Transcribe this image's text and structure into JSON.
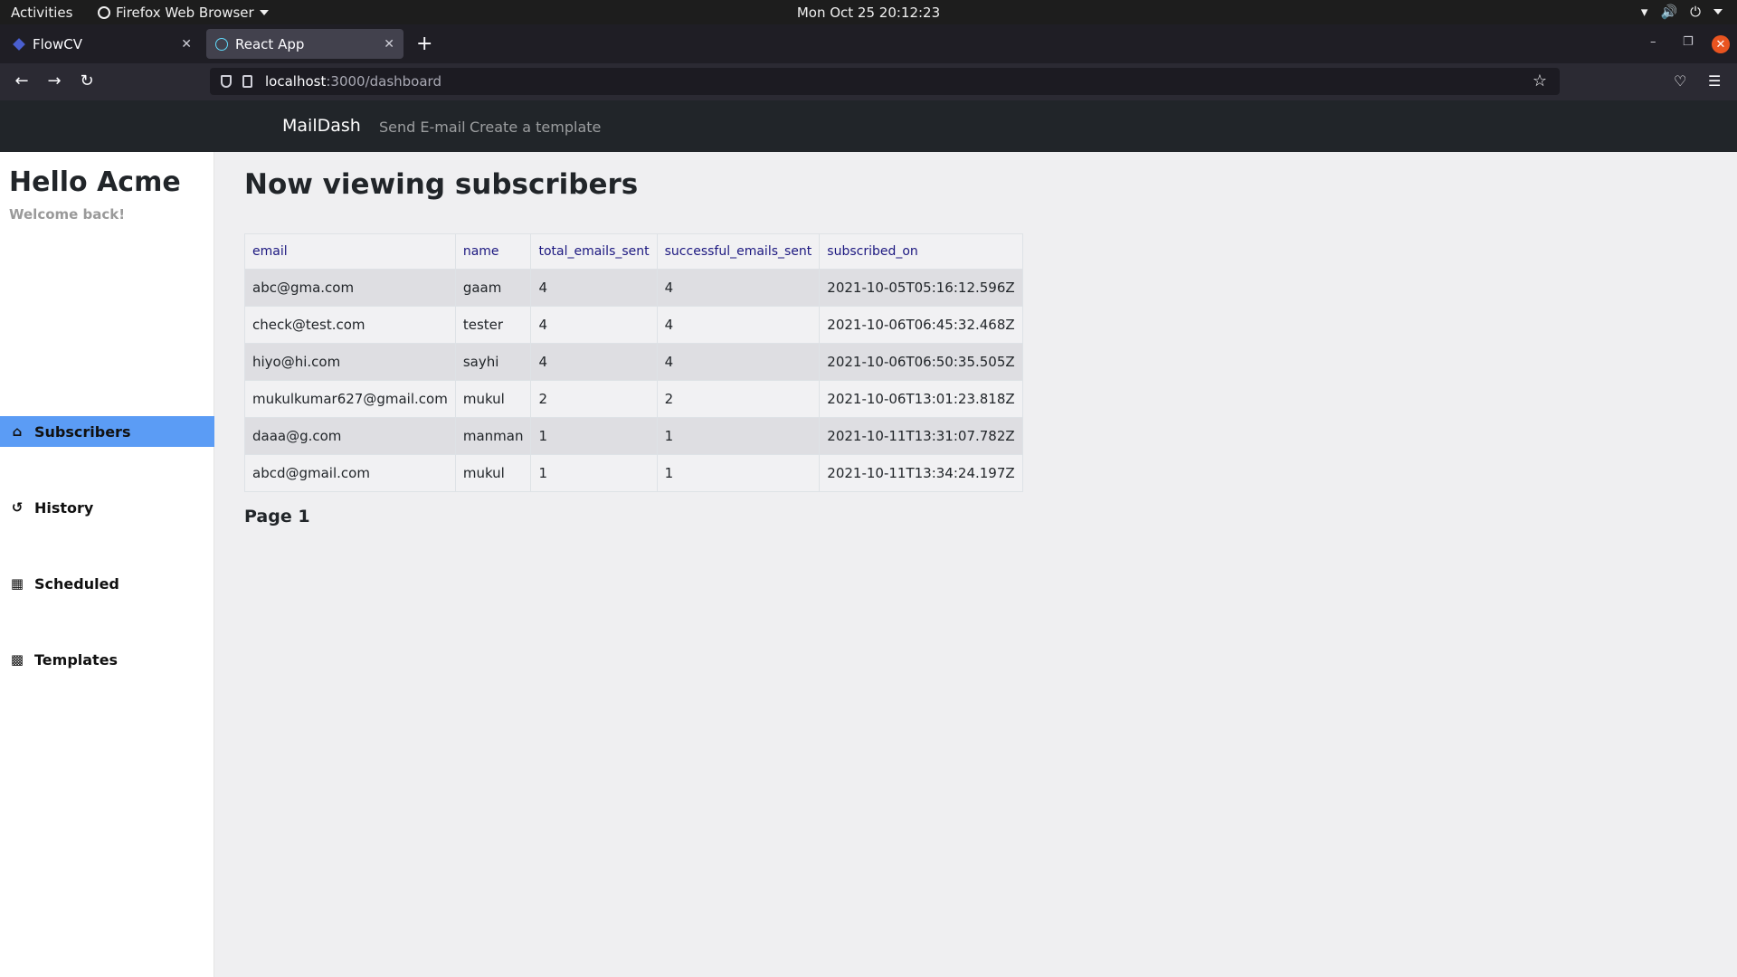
{
  "os": {
    "activities": "Activities",
    "app_name": "Firefox Web Browser",
    "clock": "Mon Oct 25  20:12:23"
  },
  "browser": {
    "tabs": [
      {
        "label": "FlowCV",
        "active": false
      },
      {
        "label": "React App",
        "active": true
      }
    ],
    "url_host": "localhost",
    "url_path": ":3000/dashboard"
  },
  "app": {
    "brand": "MailDash",
    "nav_links": [
      "Send E-mail",
      "Create a template"
    ],
    "sidebar": {
      "greeting": "Hello Acme",
      "welcome": "Welcome back!",
      "items": [
        {
          "label": "Subscribers",
          "icon": "home-icon",
          "active": true
        },
        {
          "label": "History",
          "icon": "history-icon",
          "active": false
        },
        {
          "label": "Scheduled",
          "icon": "calendar-icon",
          "active": false
        },
        {
          "label": "Templates",
          "icon": "book-icon",
          "active": false
        }
      ]
    },
    "main": {
      "title": "Now viewing subscribers",
      "table": {
        "columns": [
          "email",
          "name",
          "total_emails_sent",
          "successful_emails_sent",
          "subscribed_on"
        ],
        "rows": [
          [
            "abc@gma.com",
            "gaam",
            "4",
            "4",
            "2021-10-05T05:16:12.596Z"
          ],
          [
            "check@test.com",
            "tester",
            "4",
            "4",
            "2021-10-06T06:45:32.468Z"
          ],
          [
            "hiyo@hi.com",
            "sayhi",
            "4",
            "4",
            "2021-10-06T06:50:35.505Z"
          ],
          [
            "mukulkumar627@gmail.com",
            "mukul",
            "2",
            "2",
            "2021-10-06T13:01:23.818Z"
          ],
          [
            "daaa@g.com",
            "manman",
            "1",
            "1",
            "2021-10-11T13:31:07.782Z"
          ],
          [
            "abcd@gmail.com",
            "mukul",
            "1",
            "1",
            "2021-10-11T13:34:24.197Z"
          ]
        ]
      },
      "pagination": "Page 1"
    }
  },
  "colors": {
    "accent": "#5b9cf5",
    "navbar": "#212529",
    "header_text": "#1c1880"
  }
}
